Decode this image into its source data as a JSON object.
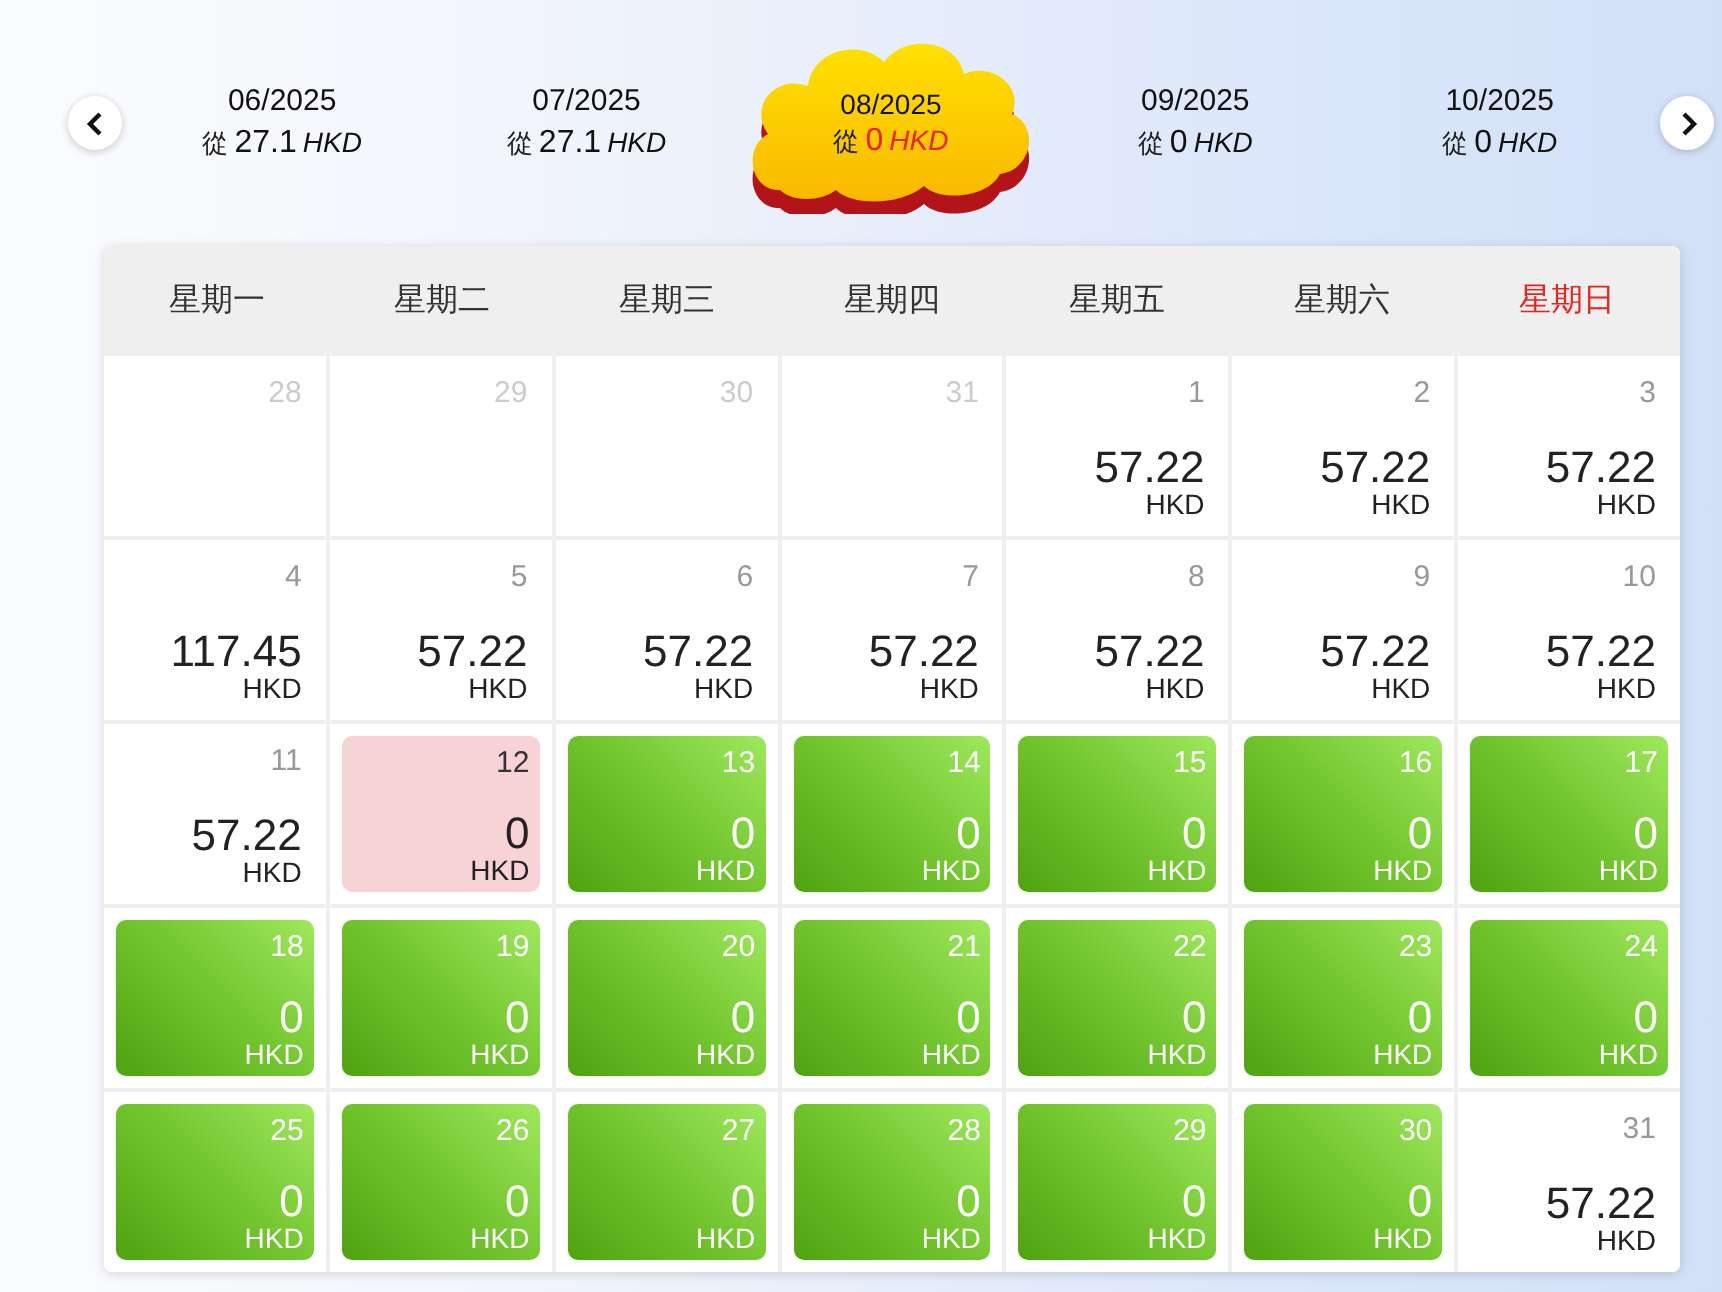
{
  "months": [
    {
      "label": "06/2025",
      "prefix": "從",
      "price": "27.1",
      "currency": "HKD",
      "selected": false
    },
    {
      "label": "07/2025",
      "prefix": "從",
      "price": "27.1",
      "currency": "HKD",
      "selected": false
    },
    {
      "label": "08/2025",
      "prefix": "從",
      "price": "0",
      "currency": "HKD",
      "selected": true
    },
    {
      "label": "09/2025",
      "prefix": "從",
      "price": "0",
      "currency": "HKD",
      "selected": false
    },
    {
      "label": "10/2025",
      "prefix": "從",
      "price": "0",
      "currency": "HKD",
      "selected": false
    }
  ],
  "weekdays": [
    {
      "label": "星期一",
      "weekend": false
    },
    {
      "label": "星期二",
      "weekend": false
    },
    {
      "label": "星期三",
      "weekend": false
    },
    {
      "label": "星期四",
      "weekend": false
    },
    {
      "label": "星期五",
      "weekend": false
    },
    {
      "label": "星期六",
      "weekend": false
    },
    {
      "label": "星期日",
      "weekend": true
    }
  ],
  "weeks": [
    [
      {
        "day": "28",
        "kind": "outside"
      },
      {
        "day": "29",
        "kind": "outside"
      },
      {
        "day": "30",
        "kind": "outside"
      },
      {
        "day": "31",
        "kind": "outside"
      },
      {
        "day": "1",
        "kind": "priced",
        "price": "57.22",
        "currency": "HKD"
      },
      {
        "day": "2",
        "kind": "priced",
        "price": "57.22",
        "currency": "HKD"
      },
      {
        "day": "3",
        "kind": "priced",
        "price": "57.22",
        "currency": "HKD"
      }
    ],
    [
      {
        "day": "4",
        "kind": "priced",
        "price": "117.45",
        "currency": "HKD"
      },
      {
        "day": "5",
        "kind": "priced",
        "price": "57.22",
        "currency": "HKD"
      },
      {
        "day": "6",
        "kind": "priced",
        "price": "57.22",
        "currency": "HKD"
      },
      {
        "day": "7",
        "kind": "priced",
        "price": "57.22",
        "currency": "HKD"
      },
      {
        "day": "8",
        "kind": "priced",
        "price": "57.22",
        "currency": "HKD"
      },
      {
        "day": "9",
        "kind": "priced",
        "price": "57.22",
        "currency": "HKD"
      },
      {
        "day": "10",
        "kind": "priced",
        "price": "57.22",
        "currency": "HKD"
      }
    ],
    [
      {
        "day": "11",
        "kind": "priced",
        "price": "57.22",
        "currency": "HKD"
      },
      {
        "day": "12",
        "kind": "selected",
        "price": "0",
        "currency": "HKD"
      },
      {
        "day": "13",
        "kind": "offer",
        "price": "0",
        "currency": "HKD"
      },
      {
        "day": "14",
        "kind": "offer",
        "price": "0",
        "currency": "HKD"
      },
      {
        "day": "15",
        "kind": "offer",
        "price": "0",
        "currency": "HKD"
      },
      {
        "day": "16",
        "kind": "offer",
        "price": "0",
        "currency": "HKD"
      },
      {
        "day": "17",
        "kind": "offer",
        "price": "0",
        "currency": "HKD"
      }
    ],
    [
      {
        "day": "18",
        "kind": "offer",
        "price": "0",
        "currency": "HKD"
      },
      {
        "day": "19",
        "kind": "offer",
        "price": "0",
        "currency": "HKD"
      },
      {
        "day": "20",
        "kind": "offer",
        "price": "0",
        "currency": "HKD"
      },
      {
        "day": "21",
        "kind": "offer",
        "price": "0",
        "currency": "HKD"
      },
      {
        "day": "22",
        "kind": "offer",
        "price": "0",
        "currency": "HKD"
      },
      {
        "day": "23",
        "kind": "offer",
        "price": "0",
        "currency": "HKD"
      },
      {
        "day": "24",
        "kind": "offer",
        "price": "0",
        "currency": "HKD"
      }
    ],
    [
      {
        "day": "25",
        "kind": "offer",
        "price": "0",
        "currency": "HKD"
      },
      {
        "day": "26",
        "kind": "offer",
        "price": "0",
        "currency": "HKD"
      },
      {
        "day": "27",
        "kind": "offer",
        "price": "0",
        "currency": "HKD"
      },
      {
        "day": "28",
        "kind": "offer",
        "price": "0",
        "currency": "HKD"
      },
      {
        "day": "29",
        "kind": "offer",
        "price": "0",
        "currency": "HKD"
      },
      {
        "day": "30",
        "kind": "offer",
        "price": "0",
        "currency": "HKD"
      },
      {
        "day": "31",
        "kind": "priced",
        "price": "57.22",
        "currency": "HKD"
      }
    ]
  ]
}
